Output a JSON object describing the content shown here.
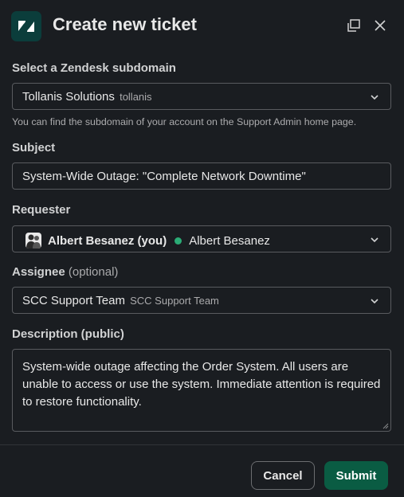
{
  "header": {
    "title": "Create new ticket",
    "logo_icon": "zendesk-logo",
    "popout_icon": "popout-icon",
    "close_icon": "close-icon"
  },
  "subdomain": {
    "label": "Select a Zendesk subdomain",
    "value": "Tollanis Solutions",
    "value_sub": "tollanis",
    "hint": "You can find the subdomain of your account on the Support Admin home page."
  },
  "subject": {
    "label": "Subject",
    "value": "System-Wide Outage: \"Complete Network Downtime\""
  },
  "requester": {
    "label": "Requester",
    "name": "Albert Besanez (you)",
    "display": "Albert Besanez",
    "status_color": "#2bac76"
  },
  "assignee": {
    "label": "Assignee",
    "optional": "(optional)",
    "value": "SCC Support Team",
    "value_sub": "SCC Support Team"
  },
  "description": {
    "label": "Description (public)",
    "value": "System-wide outage affecting the Order System. All users are unable to access or use the system. Immediate attention is required to restore functionality."
  },
  "footer": {
    "cancel_label": "Cancel",
    "submit_label": "Submit",
    "submit_color": "#0a5c43"
  }
}
